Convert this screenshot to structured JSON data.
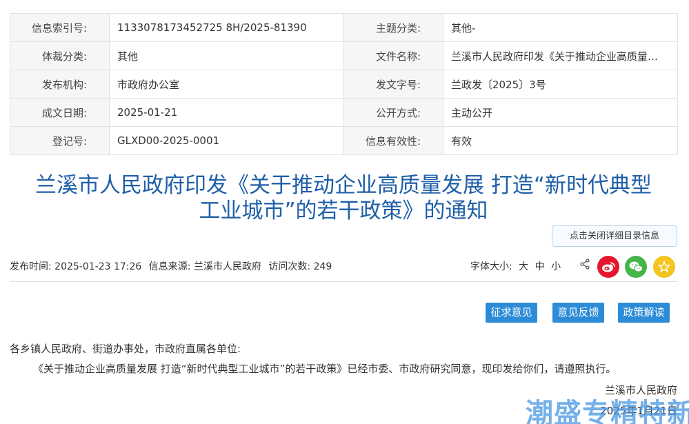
{
  "meta": {
    "rows": [
      {
        "k1": "信息索引号:",
        "v1": "1133078173452725 8H/2025-81390",
        "k2": "主题分类:",
        "v2": "其他-"
      },
      {
        "k1": "体裁分类:",
        "v1": "其他",
        "k2": "文件名称:",
        "v2": "兰溪市人民政府印发《关于推动企业高质量…"
      },
      {
        "k1": "发布机构:",
        "v1": "市政府办公室",
        "k2": "发文字号:",
        "v2": "兰政发〔2025〕3号"
      },
      {
        "k1": "成文日期:",
        "v1": "2025-01-21",
        "k2": "公开方式:",
        "v2": "主动公开"
      },
      {
        "k1": "登记号:",
        "v1": "GLXD00-2025-0001",
        "k2": "信息有效性:",
        "v2": "有效"
      }
    ]
  },
  "title": {
    "line1": "兰溪市人民政府印发《关于推动企业高质量发展 打造“新时代典型",
    "line2": "工业城市”的若干政策》的通知"
  },
  "toggle_label": "点击关闭详细目录信息",
  "info": {
    "publish_time": "发布时间:  2025-01-23  17:26",
    "source": "信息来源: 兰溪市人民政府",
    "visits": "访问次数: 249",
    "font_size_label": "字体大小:",
    "font_large": "大",
    "font_medium": "中",
    "font_small": "小"
  },
  "actions": {
    "solicit": "征求意见",
    "feedback": "意见反馈",
    "interpret": "政策解读"
  },
  "body": {
    "salutation": "各乡镇人民政府、街道办事处，市政府直属各单位:",
    "paragraph": "《关于推动企业高质量发展 打造“新时代典型工业城市”的若干政策》已经市委、市政府研究同意，现印发给你们，请遵照执行。",
    "sign_org": "兰溪市人民政府",
    "sign_date": "2025年1月21日"
  },
  "watermark": "潮盛专精特新",
  "colors": {
    "title": "#1f5fa8",
    "button": "#2d8cd7",
    "weibo": "#e6162d",
    "wechat": "#44b549",
    "favorite": "#f4c421"
  },
  "icons": [
    "share-icon",
    "weibo-icon",
    "wechat-icon",
    "star-icon"
  ]
}
